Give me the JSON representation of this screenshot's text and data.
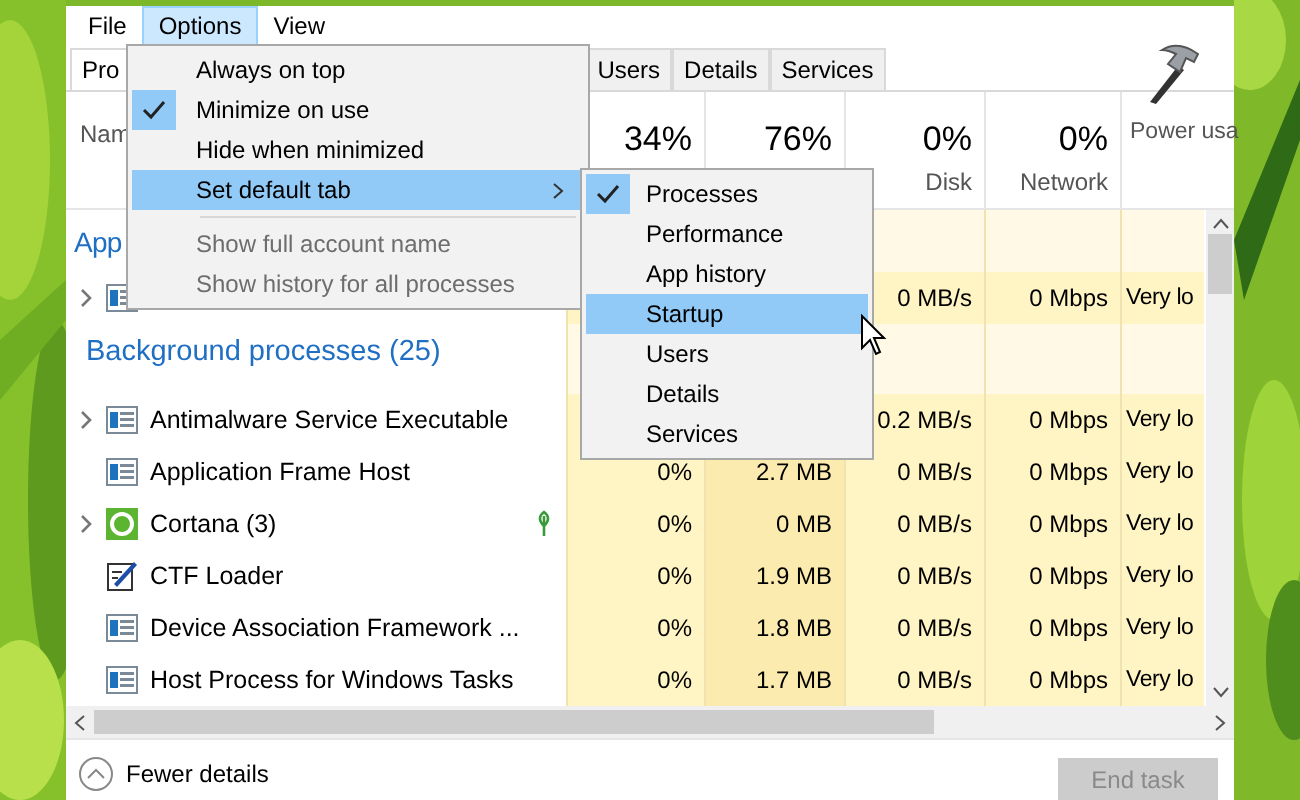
{
  "menu_bar": [
    {
      "label": "File",
      "selected": false
    },
    {
      "label": "Options",
      "selected": true
    },
    {
      "label": "View",
      "selected": false
    }
  ],
  "tabs": [
    {
      "label": "Pro",
      "selected": true
    },
    {
      "label": "Users",
      "selected": false
    },
    {
      "label": "Details",
      "selected": false
    },
    {
      "label": "Services",
      "selected": false
    }
  ],
  "header": {
    "name": "Nam",
    "cpu_percent": "34%",
    "memory_percent": "76%",
    "disk_percent": "0%",
    "disk": "Disk",
    "network_percent": "0%",
    "network": "Network",
    "power": "Power usa"
  },
  "rows": [
    {
      "kind": "group",
      "name": "App"
    },
    {
      "kind": "process",
      "expandable": true,
      "suspended": false,
      "disk": "0 MB/s",
      "network": "0 Mbps",
      "power": "Very lo"
    },
    {
      "kind": "group",
      "name": "Background processes (25)"
    },
    {
      "kind": "process",
      "expandable": true,
      "suspended": false,
      "name": "Antimalware Service Executable",
      "disk": "0.2 MB/s",
      "network": "0 Mbps",
      "power": "Very lo"
    },
    {
      "kind": "process",
      "expandable": false,
      "suspended": false,
      "name": "Application Frame Host",
      "cpu": "0%",
      "memory": "2.7 MB",
      "disk": "0 MB/s",
      "network": "0 Mbps",
      "power": "Very lo"
    },
    {
      "kind": "process",
      "expandable": true,
      "suspended": true,
      "name": "Cortana (3)",
      "cpu": "0%",
      "memory": "0 MB",
      "disk": "0 MB/s",
      "network": "0 Mbps",
      "power": "Very lo"
    },
    {
      "kind": "process",
      "expandable": false,
      "suspended": false,
      "name": "CTF Loader",
      "cpu": "0%",
      "memory": "1.9 MB",
      "disk": "0 MB/s",
      "network": "0 Mbps",
      "power": "Very lo"
    },
    {
      "kind": "process",
      "expandable": false,
      "suspended": false,
      "name": "Device Association Framework ...",
      "cpu": "0%",
      "memory": "1.8 MB",
      "disk": "0 MB/s",
      "network": "0 Mbps",
      "power": "Very lo"
    },
    {
      "kind": "process",
      "expandable": false,
      "suspended": false,
      "name": "Host Process for Windows Tasks",
      "cpu": "0%",
      "memory": "1.7 MB",
      "disk": "0 MB/s",
      "network": "0 Mbps",
      "power": "Very lo"
    }
  ],
  "footer": {
    "fewer_details": "Fewer details",
    "end_task": {
      "label": "End task",
      "disabled": true
    }
  },
  "options_menu": [
    {
      "label": "Always on top",
      "checked": false,
      "selected": false,
      "disabled": false,
      "submenu": false
    },
    {
      "label": "Minimize on use",
      "checked": true,
      "selected": false,
      "disabled": false,
      "submenu": false
    },
    {
      "label": "Hide when minimized",
      "checked": false,
      "selected": false,
      "disabled": false,
      "submenu": false
    },
    {
      "label": "Set default tab",
      "checked": false,
      "selected": true,
      "disabled": false,
      "submenu": true
    },
    {
      "label": "Show full account name",
      "checked": false,
      "selected": false,
      "disabled": true,
      "submenu": false,
      "separator_before": true
    },
    {
      "label": "Show history for all processes",
      "checked": false,
      "selected": false,
      "disabled": true,
      "submenu": false
    }
  ],
  "default_tab_submenu": [
    {
      "label": "Processes",
      "checked": true,
      "selected": false
    },
    {
      "label": "Performance",
      "checked": false,
      "selected": false
    },
    {
      "label": "App history",
      "checked": false,
      "selected": false
    },
    {
      "label": "Startup",
      "checked": false,
      "selected": true
    },
    {
      "label": "Users",
      "checked": false,
      "selected": false
    },
    {
      "label": "Details",
      "checked": false,
      "selected": false
    },
    {
      "label": "Services",
      "checked": false,
      "selected": false
    }
  ]
}
